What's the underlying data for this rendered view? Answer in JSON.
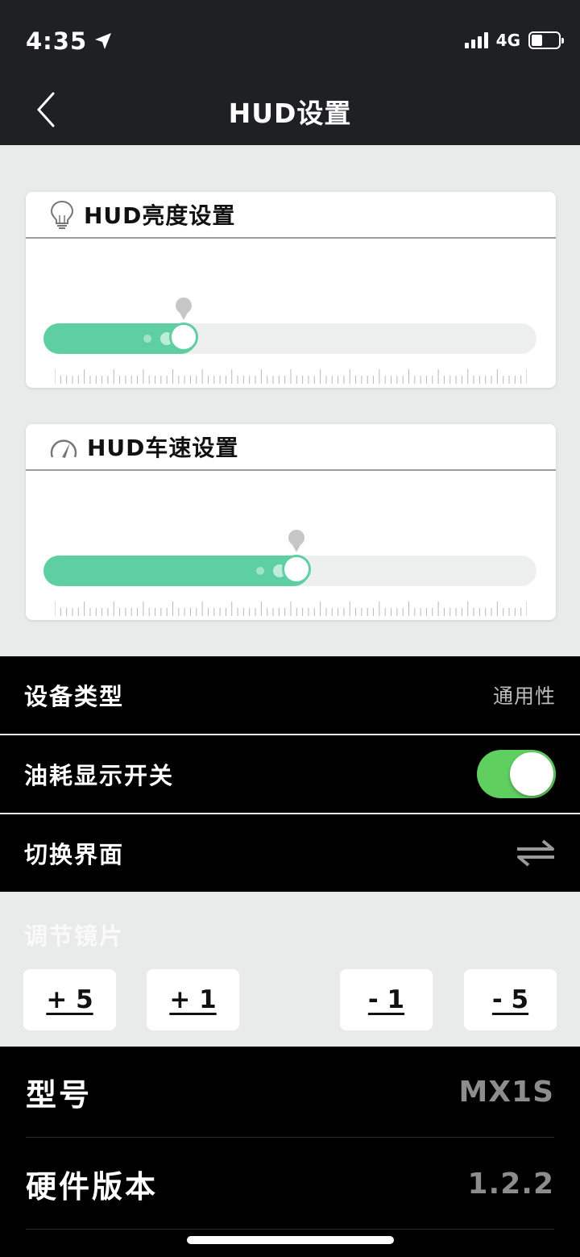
{
  "status": {
    "time": "4:35",
    "network": "4G",
    "battery_level": 0.4
  },
  "nav": {
    "title": "HUD设置"
  },
  "brightness": {
    "title": "HUD亮度设置",
    "value_fraction": 0.31,
    "accent": "#5ecfa3"
  },
  "speed": {
    "title": "HUD车速设置",
    "value_fraction": 0.54,
    "accent": "#5ecfa3"
  },
  "settings": {
    "device_type": {
      "label": "设备类型",
      "value": "通用性"
    },
    "fuel_toggle": {
      "label": "油耗显示开关",
      "on": true,
      "color": "#5fcf60"
    },
    "switch_ui": {
      "label": "切换界面"
    }
  },
  "lens": {
    "title": "调节镜片",
    "buttons": [
      "+ 5",
      "+ 1",
      "- 1",
      "- 5"
    ]
  },
  "info": {
    "model": {
      "label": "型号",
      "value": "MX1S"
    },
    "hardware": {
      "label": "硬件版本",
      "value": "1.2.2"
    }
  }
}
